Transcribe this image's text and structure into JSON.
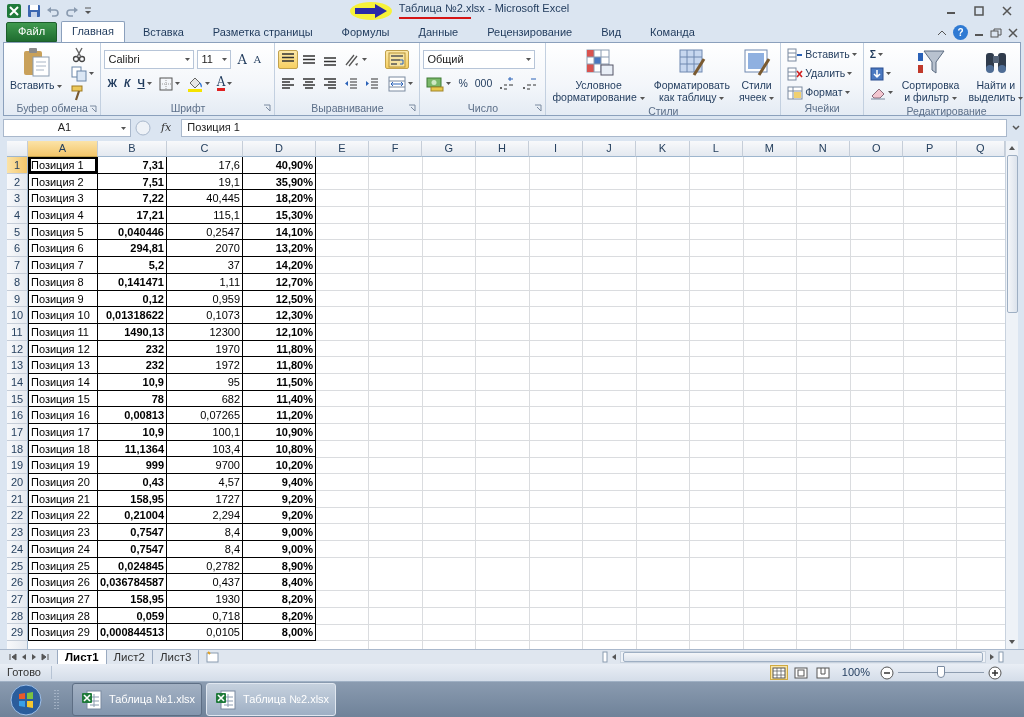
{
  "window": {
    "title": "Таблица №2.xlsx - Microsoft Excel"
  },
  "ribbon_tabs": [
    {
      "label": "Файл",
      "kind": "file",
      "selected": false
    },
    {
      "label": "Главная",
      "kind": "tab",
      "selected": true
    },
    {
      "label": "Вставка",
      "kind": "tab",
      "selected": false
    },
    {
      "label": "Разметка страницы",
      "kind": "tab",
      "selected": false
    },
    {
      "label": "Формулы",
      "kind": "tab",
      "selected": false
    },
    {
      "label": "Данные",
      "kind": "tab",
      "selected": false
    },
    {
      "label": "Рецензирование",
      "kind": "tab",
      "selected": false
    },
    {
      "label": "Вид",
      "kind": "tab",
      "selected": false
    },
    {
      "label": "Команда",
      "kind": "tab",
      "selected": false
    }
  ],
  "help": "?",
  "ribbon_groups": [
    {
      "label": "Буфер обмена",
      "launcher": true,
      "sections": [
        {
          "kind": "large",
          "lines": [
            "Вставить"
          ],
          "menu": true
        },
        {
          "kind": "stack",
          "lines": [
            {
              "controls": [
                {
                  "kind": "icon",
                  "menu": false
                }
              ]
            },
            {
              "controls": [
                {
                  "kind": "icon",
                  "menu": true
                }
              ]
            },
            {
              "controls": [
                {
                  "kind": "icon",
                  "menu": false
                }
              ]
            }
          ]
        }
      ]
    },
    {
      "label": "Шрифт",
      "launcher": true,
      "sections": [
        {
          "kind": "stack",
          "lines": [
            {
              "controls": [
                {
                  "kind": "field",
                  "value": "Calibri"
                },
                {
                  "kind": "field",
                  "value": "11"
                },
                {
                  "kind": "text",
                  "label": "A",
                  "menu": false
                },
                {
                  "kind": "text",
                  "label": "A",
                  "menu": false
                }
              ]
            },
            {
              "controls": [
                {
                  "kind": "text",
                  "label": "Ж",
                  "menu": false
                },
                {
                  "kind": "text",
                  "label": "К",
                  "menu": false
                },
                {
                  "kind": "text",
                  "label": "Ч",
                  "menu": true
                },
                {
                  "kind": "icon",
                  "menu": true
                },
                {
                  "kind": "icon",
                  "menu": true
                },
                {
                  "kind": "color",
                  "label": "A",
                  "menu": true
                }
              ]
            }
          ]
        }
      ]
    },
    {
      "label": "Выравнивание",
      "launcher": true,
      "sections": [
        {
          "kind": "stack",
          "lines": [
            {
              "controls": [
                {
                  "kind": "icon",
                  "selected": true,
                  "menu": false
                },
                {
                  "kind": "icon",
                  "selected": false,
                  "menu": false
                },
                {
                  "kind": "icon",
                  "selected": false,
                  "menu": false
                },
                {
                  "kind": "icon",
                  "selected": false,
                  "menu": true
                }
              ]
            },
            {
              "controls": [
                {
                  "kind": "icon",
                  "selected": false,
                  "menu": false
                },
                {
                  "kind": "icon",
                  "selected": false,
                  "menu": false
                },
                {
                  "kind": "icon",
                  "selected": false,
                  "menu": false
                },
                {
                  "kind": "icon",
                  "selected": false,
                  "menu": false
                },
                {
                  "kind": "icon",
                  "selected": false,
                  "menu": false
                }
              ]
            }
          ]
        },
        {
          "kind": "stack",
          "lines": [
            {
              "controls": [
                {
                  "kind": "icon",
                  "selected": true,
                  "menu": false
                }
              ]
            },
            {
              "controls": [
                {
                  "kind": "icon",
                  "selected": false,
                  "menu": true
                }
              ]
            }
          ]
        }
      ]
    },
    {
      "label": "Число",
      "launcher": true,
      "sections": [
        {
          "kind": "stack",
          "lines": [
            {
              "controls": [
                {
                  "kind": "field",
                  "value": "Общий"
                }
              ]
            },
            {
              "controls": [
                {
                  "kind": "icon",
                  "menu": true
                },
                {
                  "kind": "text",
                  "label": "%",
                  "menu": false
                },
                {
                  "kind": "text",
                  "label": "000",
                  "menu": false
                },
                {
                  "kind": "icon",
                  "menu": false
                },
                {
                  "kind": "icon",
                  "menu": false
                }
              ]
            }
          ]
        }
      ]
    },
    {
      "label": "Стили",
      "launcher": false,
      "sections": [
        {
          "kind": "large",
          "lines": [
            "Условное",
            "форматирование"
          ],
          "menu": true
        },
        {
          "kind": "large",
          "lines": [
            "Форматировать",
            "как таблицу"
          ],
          "menu": true
        },
        {
          "kind": "large",
          "lines": [
            "Стили",
            "ячеек"
          ],
          "menu": true
        }
      ]
    },
    {
      "label": "Ячейки",
      "launcher": false,
      "sections": [
        {
          "kind": "stack",
          "lines": [
            {
              "controls": [
                {
                  "kind": "small",
                  "label": "Вставить",
                  "menu": true
                }
              ]
            },
            {
              "controls": [
                {
                  "kind": "small",
                  "label": "Удалить",
                  "menu": true
                }
              ]
            },
            {
              "controls": [
                {
                  "kind": "small",
                  "label": "Формат",
                  "menu": true
                }
              ]
            }
          ]
        }
      ]
    },
    {
      "label": "Редактирование",
      "launcher": false,
      "sections": [
        {
          "kind": "stack",
          "lines": [
            {
              "controls": [
                {
                  "kind": "text",
                  "label": "Σ",
                  "menu": true
                }
              ]
            },
            {
              "controls": [
                {
                  "kind": "icon",
                  "menu": true
                }
              ]
            },
            {
              "controls": [
                {
                  "kind": "icon",
                  "menu": true
                }
              ]
            }
          ]
        },
        {
          "kind": "large",
          "lines": [
            "Сортировка",
            "и фильтр"
          ],
          "menu": true
        },
        {
          "kind": "large",
          "lines": [
            "Найти и",
            "выделить"
          ],
          "menu": true
        }
      ]
    }
  ],
  "formula_bar": {
    "name_box": "A1",
    "function_label": "fx",
    "formula": "Позиция 1"
  },
  "columns": [
    {
      "label": "A",
      "selected": true
    },
    {
      "label": "B",
      "selected": false
    },
    {
      "label": "C",
      "selected": false
    },
    {
      "label": "D",
      "selected": false
    },
    {
      "label": "E",
      "selected": false
    },
    {
      "label": "F",
      "selected": false
    },
    {
      "label": "G",
      "selected": false
    },
    {
      "label": "H",
      "selected": false
    },
    {
      "label": "I",
      "selected": false
    },
    {
      "label": "J",
      "selected": false
    },
    {
      "label": "K",
      "selected": false
    },
    {
      "label": "L",
      "selected": false
    },
    {
      "label": "M",
      "selected": false
    },
    {
      "label": "N",
      "selected": false
    },
    {
      "label": "O",
      "selected": false
    },
    {
      "label": "P",
      "selected": false
    },
    {
      "label": "Q",
      "selected": false
    }
  ],
  "rows": [
    {
      "number": "1",
      "selected": true,
      "cells": [
        "Позиция 1",
        "7,31",
        "17,6",
        "40,90%"
      ]
    },
    {
      "number": "2",
      "selected": false,
      "cells": [
        "Позиция 2",
        "7,51",
        "19,1",
        "35,90%"
      ]
    },
    {
      "number": "3",
      "selected": false,
      "cells": [
        "Позиция 3",
        "7,22",
        "40,445",
        "18,20%"
      ]
    },
    {
      "number": "4",
      "selected": false,
      "cells": [
        "Позиция 4",
        "17,21",
        "115,1",
        "15,30%"
      ]
    },
    {
      "number": "5",
      "selected": false,
      "cells": [
        "Позиция 5",
        "0,040446",
        "0,2547",
        "14,10%"
      ]
    },
    {
      "number": "6",
      "selected": false,
      "cells": [
        "Позиция 6",
        "294,81",
        "2070",
        "13,20%"
      ]
    },
    {
      "number": "7",
      "selected": false,
      "cells": [
        "Позиция 7",
        "5,2",
        "37",
        "14,20%"
      ]
    },
    {
      "number": "8",
      "selected": false,
      "cells": [
        "Позиция 8",
        "0,141471",
        "1,11",
        "12,70%"
      ]
    },
    {
      "number": "9",
      "selected": false,
      "cells": [
        "Позиция 9",
        "0,12",
        "0,959",
        "12,50%"
      ]
    },
    {
      "number": "10",
      "selected": false,
      "cells": [
        "Позиция 10",
        "0,01318622",
        "0,1073",
        "12,30%"
      ]
    },
    {
      "number": "11",
      "selected": false,
      "cells": [
        "Позиция 11",
        "1490,13",
        "12300",
        "12,10%"
      ]
    },
    {
      "number": "12",
      "selected": false,
      "cells": [
        "Позиция 12",
        "232",
        "1970",
        "11,80%"
      ]
    },
    {
      "number": "13",
      "selected": false,
      "cells": [
        "Позиция 13",
        "232",
        "1972",
        "11,80%"
      ]
    },
    {
      "number": "14",
      "selected": false,
      "cells": [
        "Позиция 14",
        "10,9",
        "95",
        "11,50%"
      ]
    },
    {
      "number": "15",
      "selected": false,
      "cells": [
        "Позиция 15",
        "78",
        "682",
        "11,40%"
      ]
    },
    {
      "number": "16",
      "selected": false,
      "cells": [
        "Позиция 16",
        "0,00813",
        "0,07265",
        "11,20%"
      ]
    },
    {
      "number": "17",
      "selected": false,
      "cells": [
        "Позиция 17",
        "10,9",
        "100,1",
        "10,90%"
      ]
    },
    {
      "number": "18",
      "selected": false,
      "cells": [
        "Позиция 18",
        "11,1364",
        "103,4",
        "10,80%"
      ]
    },
    {
      "number": "19",
      "selected": false,
      "cells": [
        "Позиция 19",
        "999",
        "9700",
        "10,20%"
      ]
    },
    {
      "number": "20",
      "selected": false,
      "cells": [
        "Позиция 20",
        "0,43",
        "4,57",
        "9,40%"
      ]
    },
    {
      "number": "21",
      "selected": false,
      "cells": [
        "Позиция 21",
        "158,95",
        "1727",
        "9,20%"
      ]
    },
    {
      "number": "22",
      "selected": false,
      "cells": [
        "Позиция 22",
        "0,21004",
        "2,294",
        "9,20%"
      ]
    },
    {
      "number": "23",
      "selected": false,
      "cells": [
        "Позиция 23",
        "0,7547",
        "8,4",
        "9,00%"
      ]
    },
    {
      "number": "24",
      "selected": false,
      "cells": [
        "Позиция 24",
        "0,7547",
        "8,4",
        "9,00%"
      ]
    },
    {
      "number": "25",
      "selected": false,
      "cells": [
        "Позиция 25",
        "0,024845",
        "0,2782",
        "8,90%"
      ]
    },
    {
      "number": "26",
      "selected": false,
      "cells": [
        "Позиция 26",
        "0,036784587",
        "0,437",
        "8,40%"
      ]
    },
    {
      "number": "27",
      "selected": false,
      "cells": [
        "Позиция 27",
        "158,95",
        "1930",
        "8,20%"
      ]
    },
    {
      "number": "28",
      "selected": false,
      "cells": [
        "Позиция 28",
        "0,059",
        "0,718",
        "8,20%"
      ]
    },
    {
      "number": "29",
      "selected": false,
      "cells": [
        "Позиция 29",
        "0,000844513",
        "0,0105",
        "8,00%"
      ]
    }
  ],
  "sheet_tabs": [
    {
      "label": "Лист1",
      "selected": true
    },
    {
      "label": "Лист2",
      "selected": false
    },
    {
      "label": "Лист3",
      "selected": false
    }
  ],
  "status_bar": {
    "status": "Готово",
    "views": [
      {
        "kind": "normal",
        "selected": true
      },
      {
        "kind": "layout",
        "selected": false
      },
      {
        "kind": "pagebreak",
        "selected": false
      }
    ],
    "zoom": "100%",
    "zoom_slider": {
      "level": 0.5
    }
  },
  "taskbar": [
    {
      "label": "Таблица №1.xlsx",
      "selected": false
    },
    {
      "label": "Таблица №2.xlsx",
      "selected": true
    }
  ]
}
